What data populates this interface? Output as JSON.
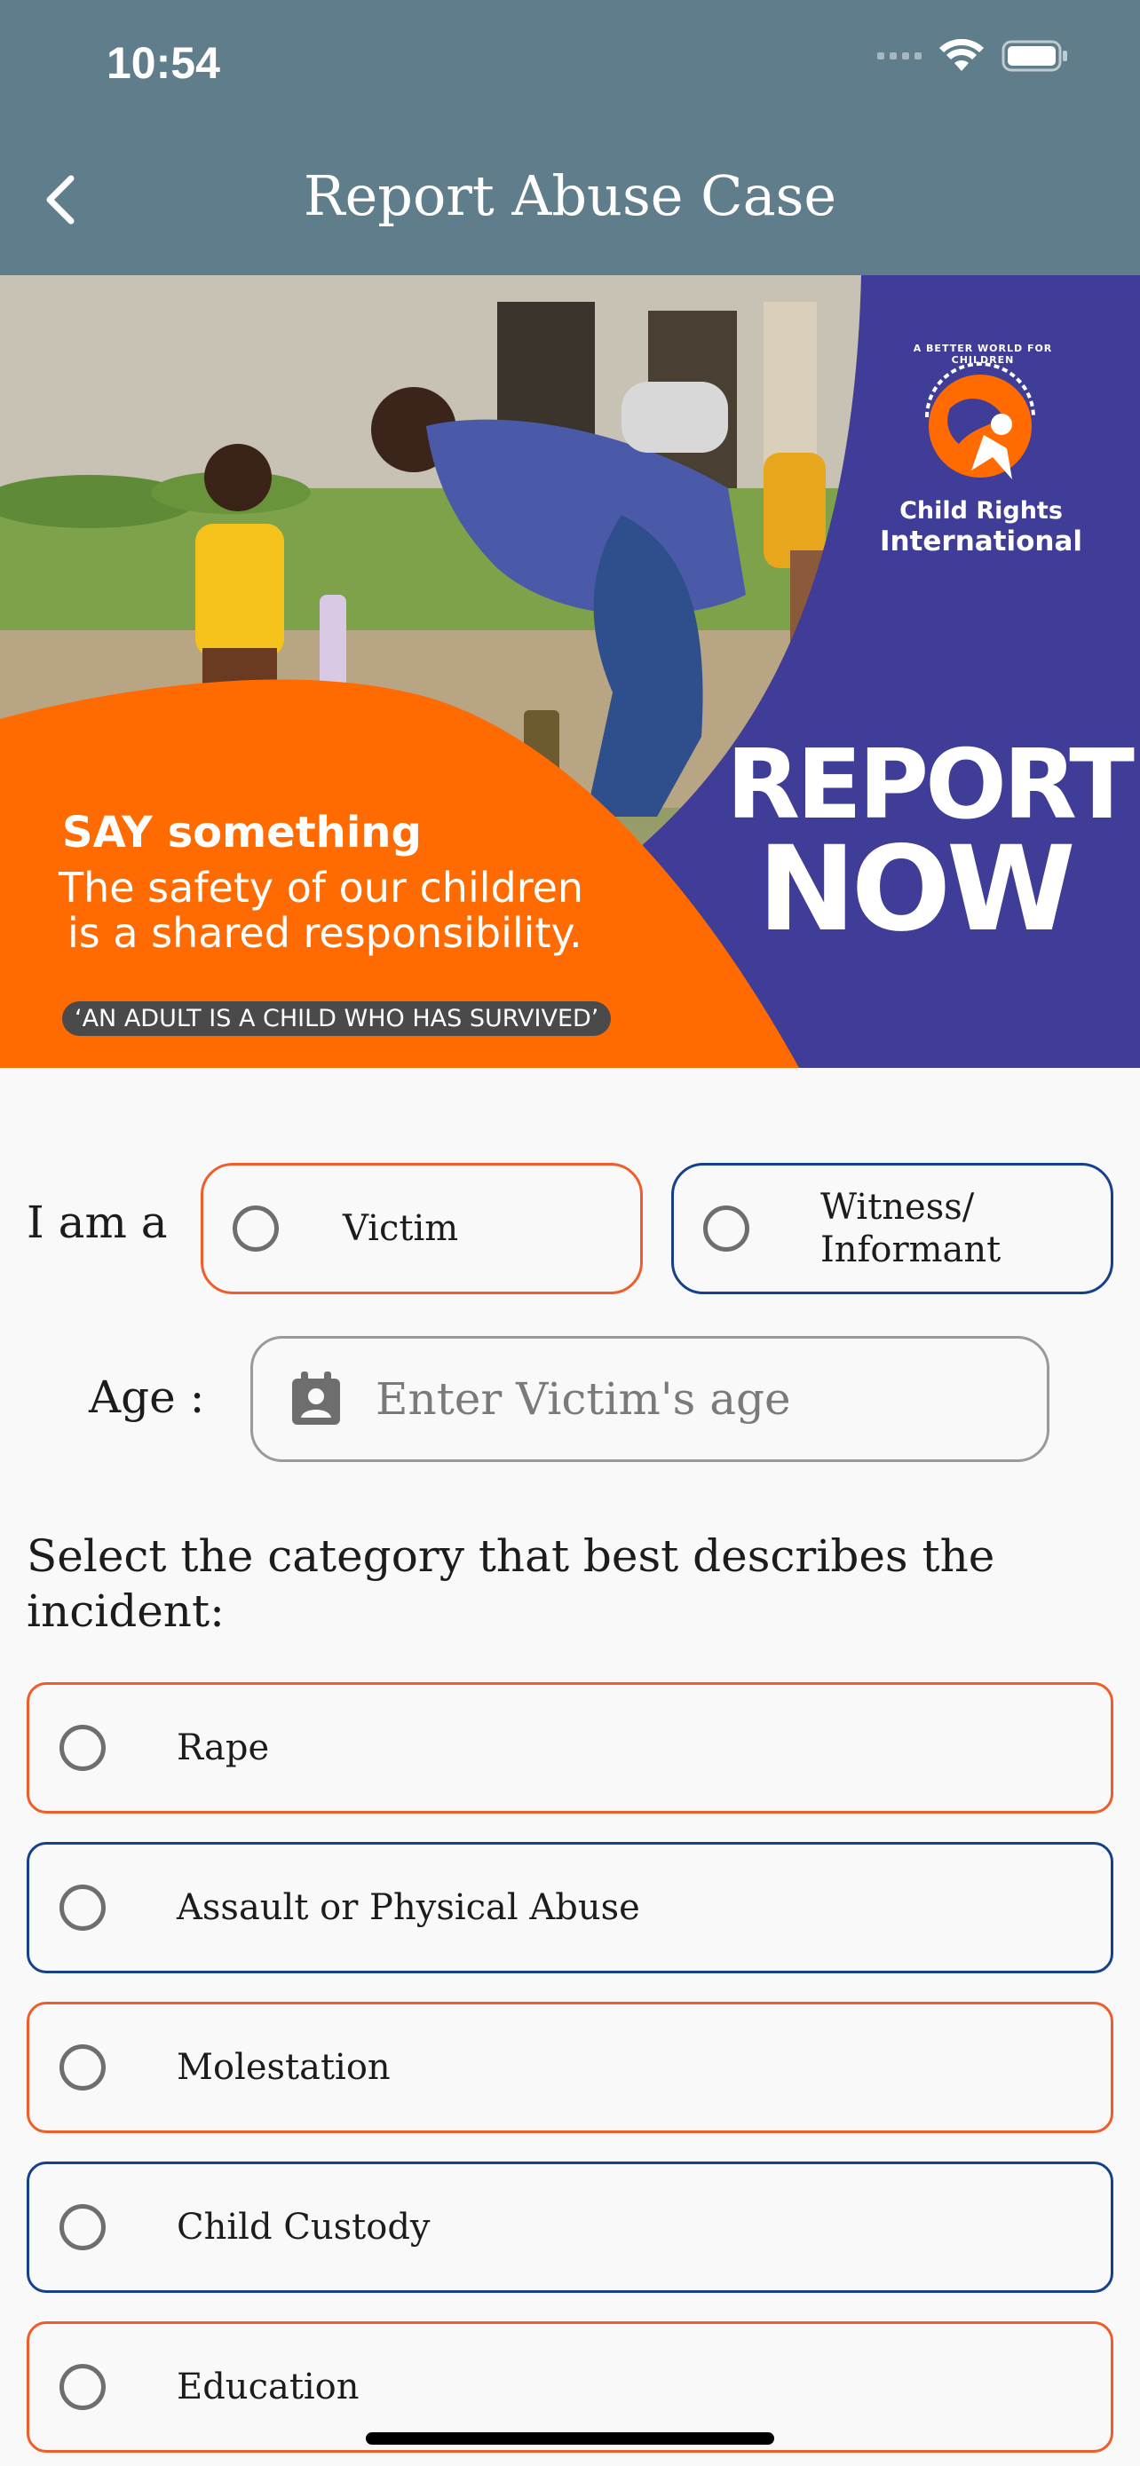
{
  "status_bar": {
    "time": "10:54"
  },
  "header": {
    "title": "Report Abuse Case"
  },
  "banner": {
    "logo_text_line1": "Child Rights",
    "logo_text_line2": "International",
    "logo_arc_text": "A BETTER WORLD FOR CHILDREN",
    "headline": "SAY something",
    "subline1": "The safety of our children",
    "subline2": "is a shared responsibility.",
    "quote": "‘AN ADULT IS A CHILD WHO HAS SURVIVED’",
    "cta1": "REPORT",
    "cta2": "NOW",
    "colors": {
      "orange": "#ff6b00",
      "purple": "#3f3d98"
    }
  },
  "form": {
    "iam_label": "I am a",
    "roles": [
      {
        "label": "Victim"
      },
      {
        "label_line1": "Witness/",
        "label_line2": "Informant"
      }
    ],
    "age_label": "Age :",
    "age_placeholder": "Enter Victim's age",
    "category_question": "Select the category that best describes the incident:",
    "categories": [
      {
        "label": "Rape"
      },
      {
        "label": "Assault or Physical Abuse"
      },
      {
        "label": "Molestation"
      },
      {
        "label": "Child Custody"
      },
      {
        "label": "Education"
      }
    ]
  },
  "colors": {
    "header": "#607d8b",
    "accent_orange": "#ef5d2a",
    "accent_blue": "#15408c"
  }
}
